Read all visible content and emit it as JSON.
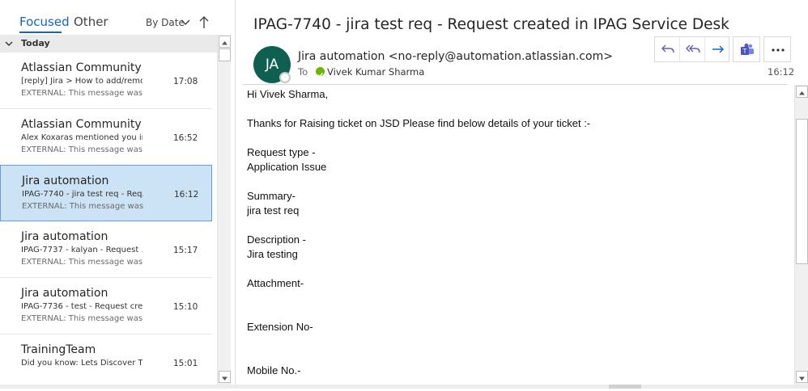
{
  "tabs": {
    "focused": "Focused",
    "other": "Other"
  },
  "sort": {
    "label": "By Date",
    "chevron_icon": "chevron-down-icon",
    "direction_icon": "arrow-up-icon"
  },
  "group": {
    "label": "Today"
  },
  "messages": [
    {
      "sender": "Atlassian Community",
      "subject": "[reply] Jira > How to add/remo...",
      "time": "17:08",
      "preview": "EXTERNAL: This message was",
      "selected": false
    },
    {
      "sender": "Atlassian Community",
      "subject": "Alex Koxaras mentioned you in...",
      "time": "16:52",
      "preview": "EXTERNAL: This message was",
      "selected": false
    },
    {
      "sender": "Jira automation",
      "subject": "IPAG-7740 - jira test req - Req...",
      "time": "16:12",
      "preview": "EXTERNAL: This message was",
      "selected": true
    },
    {
      "sender": "Jira automation",
      "subject": "IPAG-7737 - kalyan - Request ...",
      "time": "15:17",
      "preview": "EXTERNAL: This message was",
      "selected": false
    },
    {
      "sender": "Jira automation",
      "subject": "IPAG-7736 - test - Request cre...",
      "time": "15:10",
      "preview": "EXTERNAL: This message was",
      "selected": false
    },
    {
      "sender": "TrainingTeam",
      "subject": "Did you know: Lets Discover T...",
      "time": "15:01",
      "preview": "",
      "selected": false
    }
  ],
  "reading": {
    "title": "IPAG-7740 - jira test req - Request created in IPAG Service Desk",
    "avatar_initials": "JA",
    "from": "Jira automation <no-reply@automation.atlassian.com>",
    "to_label": "To",
    "to_name": "Vivek Kumar Sharma",
    "time": "16:12",
    "actions": [
      "reply-icon",
      "reply-all-icon",
      "forward-icon",
      "teams-icon",
      "more-icon"
    ],
    "colors": {
      "avatar": "#0f6050",
      "accent": "#1466b8",
      "selected": "#cce2f5",
      "presence": "#6bb700",
      "teams": "#5059c9"
    }
  },
  "body_lines": [
    "Hi Vivek Sharma,",
    "",
    "Thanks for Raising ticket on JSD Please find below details of your ticket :-",
    "",
    "Request type -",
    "Application Issue",
    "",
    "Summary-",
    "jira test req",
    "",
    "Description -",
    "Jira testing",
    "",
    "Attachment-",
    "",
    "",
    "Extension No-",
    "",
    "",
    "Mobile No.-"
  ]
}
